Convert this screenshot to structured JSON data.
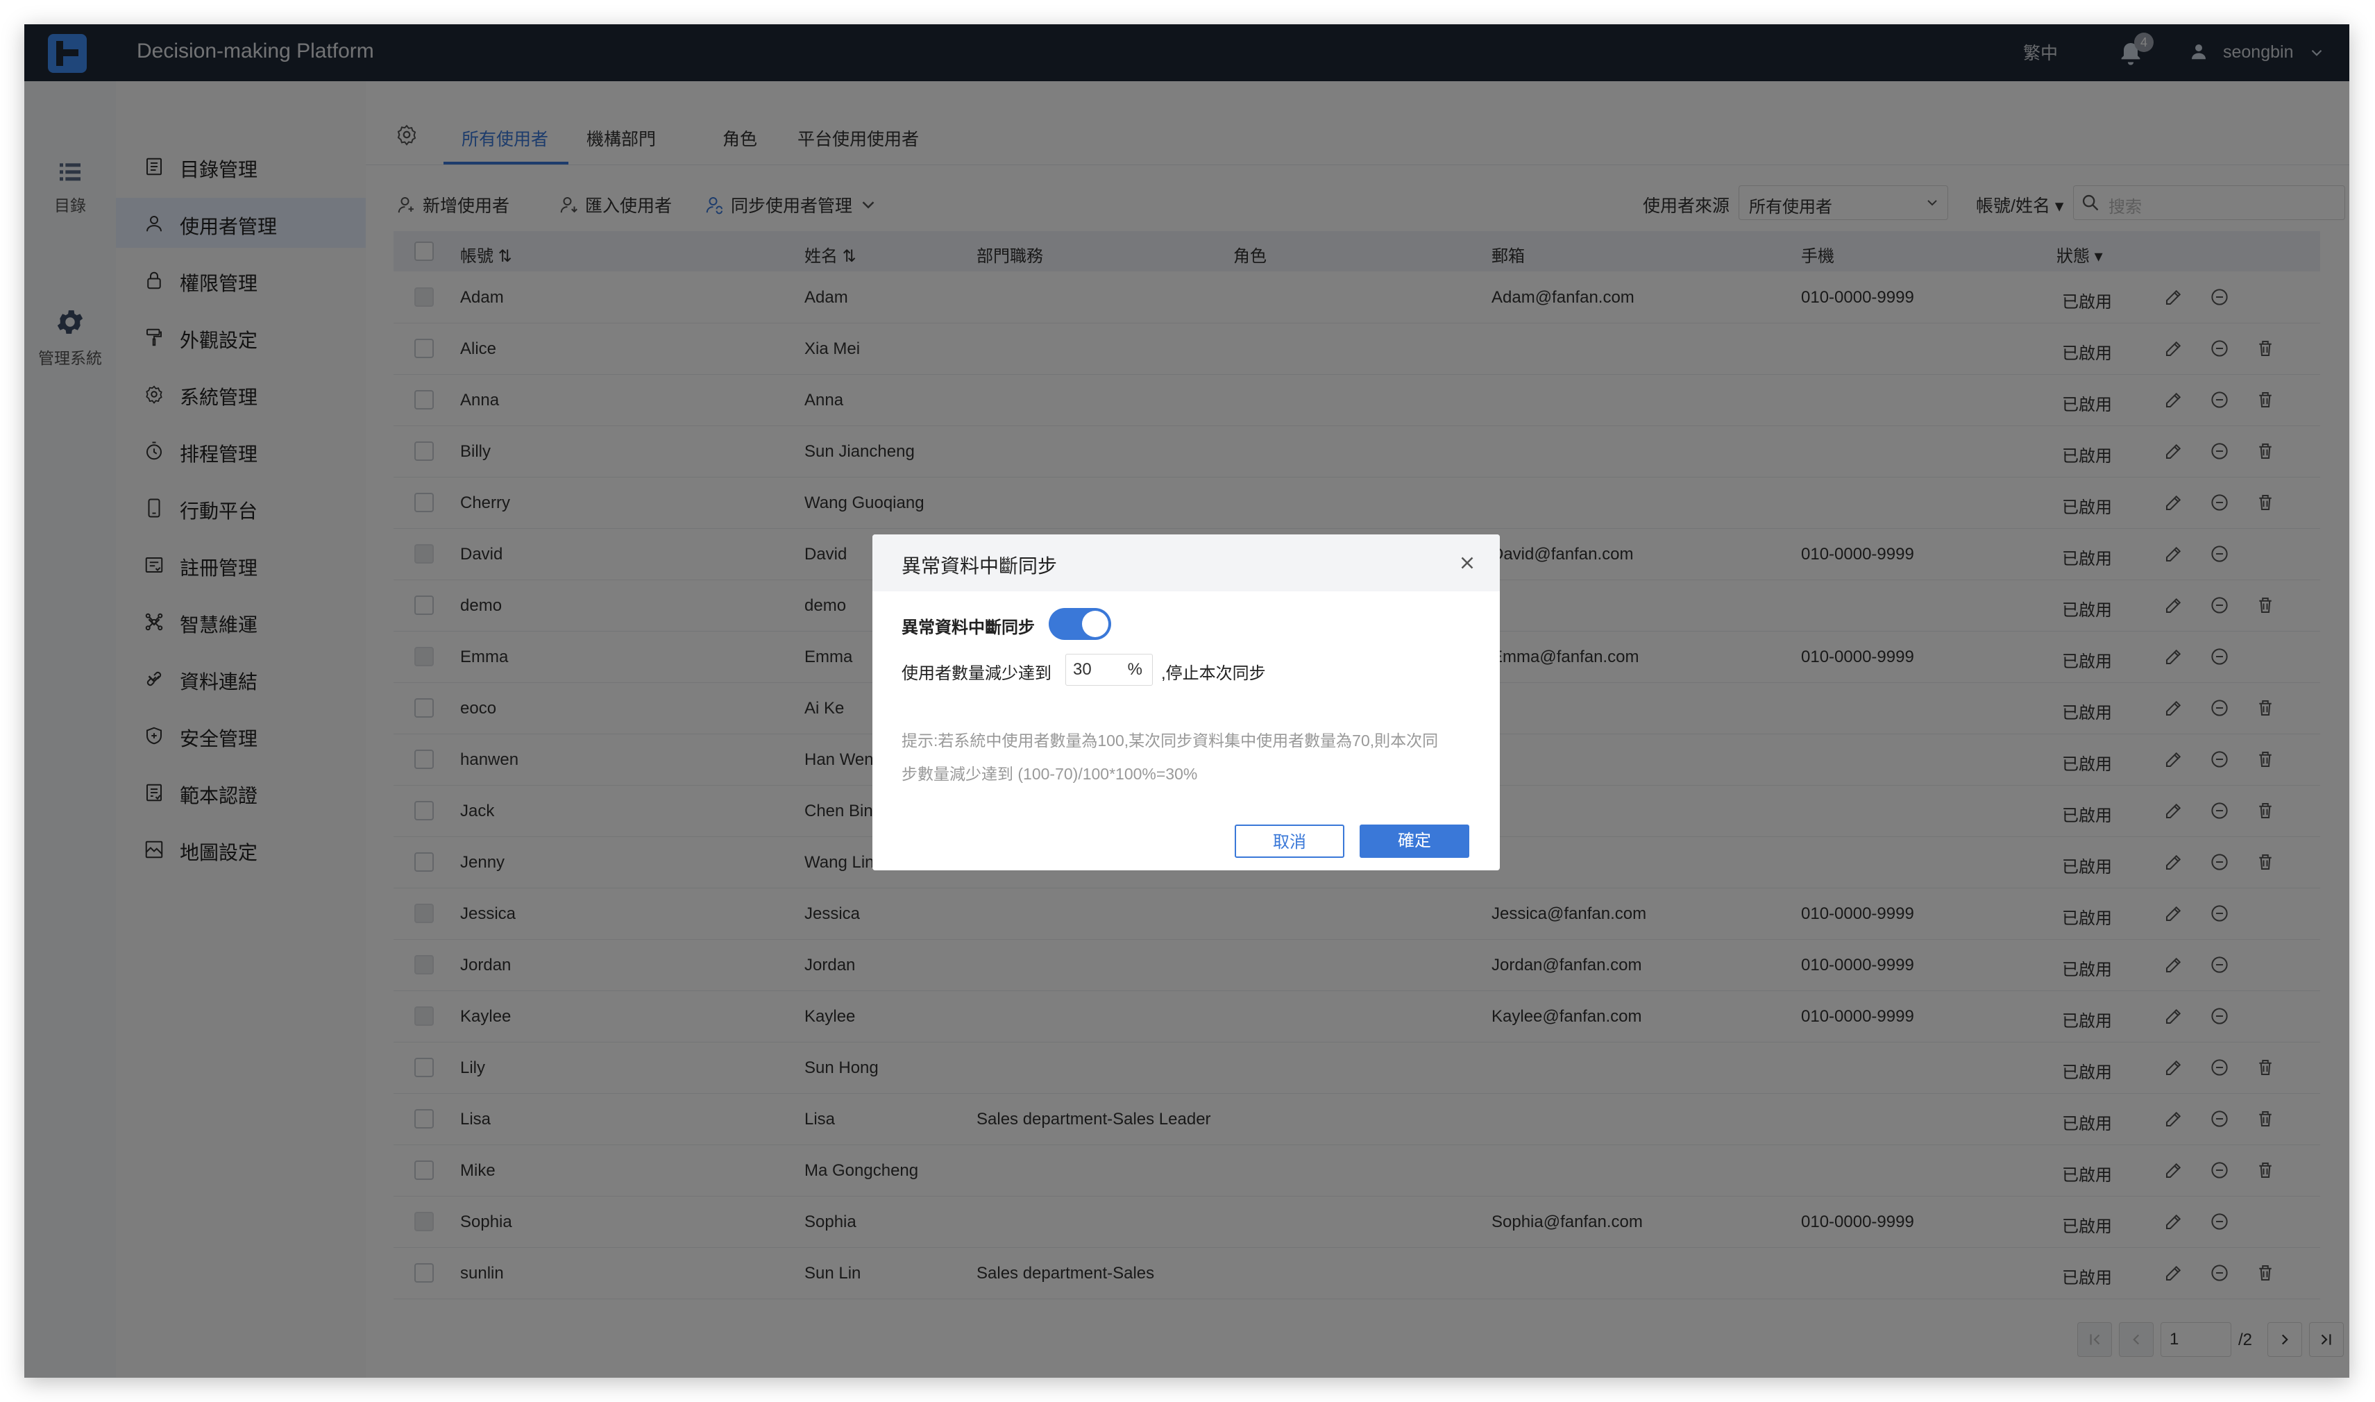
{
  "app": {
    "title": "Decision-making Platform",
    "language": "繁中",
    "notification_count": "4",
    "username": "seongbin"
  },
  "rail": [
    {
      "label": "目錄",
      "icon": "list-icon"
    },
    {
      "label": "管理系統",
      "icon": "gear-icon"
    }
  ],
  "sidebar": {
    "items": [
      {
        "label": "目錄管理",
        "icon": "catalog-icon",
        "active": false
      },
      {
        "label": "使用者管理",
        "icon": "user-icon",
        "active": true
      },
      {
        "label": "權限管理",
        "icon": "lock-icon",
        "active": false
      },
      {
        "label": "外觀設定",
        "icon": "paint-roller-icon",
        "active": false
      },
      {
        "label": "系統管理",
        "icon": "settings-icon",
        "active": false
      },
      {
        "label": "排程管理",
        "icon": "timer-icon",
        "active": false
      },
      {
        "label": "行動平台",
        "icon": "mobile-icon",
        "active": false
      },
      {
        "label": "註冊管理",
        "icon": "register-icon",
        "active": false
      },
      {
        "label": "智慧維運",
        "icon": "network-icon",
        "active": false,
        "expandable": true
      },
      {
        "label": "資料連結",
        "icon": "link-icon",
        "active": false,
        "expandable": true
      },
      {
        "label": "安全管理",
        "icon": "shield-icon",
        "active": false
      },
      {
        "label": "範本認證",
        "icon": "template-icon",
        "active": false
      },
      {
        "label": "地圖設定",
        "icon": "map-icon",
        "active": false
      }
    ]
  },
  "tabs": [
    {
      "label": "所有使用者",
      "active": true
    },
    {
      "label": "機構部門",
      "active": false
    },
    {
      "label": "角色",
      "active": false
    },
    {
      "label": "平台使用使用者",
      "active": false
    }
  ],
  "toolbar": {
    "add_user": "新增使用者",
    "import_user": "匯入使用者",
    "sync_user": "同步使用者管理",
    "source_label": "使用者來源",
    "source_value": "所有使用者",
    "search_field": "帳號/姓名",
    "search_placeholder": "搜索"
  },
  "table": {
    "columns": [
      "帳號",
      "姓名",
      "部門職務",
      "角色",
      "郵箱",
      "手機",
      "狀態"
    ],
    "rows": [
      {
        "account": "Adam",
        "name": "Adam",
        "dept": "",
        "role": "",
        "email": "Adam@fanfan.com",
        "phone": "010-0000-9999",
        "status": "已啟用",
        "deletable": false
      },
      {
        "account": "Alice",
        "name": "Xia Mei",
        "dept": "",
        "role": "",
        "email": "",
        "phone": "",
        "status": "已啟用",
        "deletable": true
      },
      {
        "account": "Anna",
        "name": "Anna",
        "dept": "",
        "role": "",
        "email": "",
        "phone": "",
        "status": "已啟用",
        "deletable": true
      },
      {
        "account": "Billy",
        "name": "Sun Jiancheng",
        "dept": "",
        "role": "",
        "email": "",
        "phone": "",
        "status": "已啟用",
        "deletable": true
      },
      {
        "account": "Cherry",
        "name": "Wang Guoqiang",
        "dept": "",
        "role": "",
        "email": "",
        "phone": "",
        "status": "已啟用",
        "deletable": true
      },
      {
        "account": "David",
        "name": "David",
        "dept": "",
        "role": "",
        "email": "David@fanfan.com",
        "phone": "010-0000-9999",
        "status": "已啟用",
        "deletable": false
      },
      {
        "account": "demo",
        "name": "demo",
        "dept": "",
        "role": "",
        "email": "",
        "phone": "",
        "status": "已啟用",
        "deletable": true
      },
      {
        "account": "Emma",
        "name": "Emma",
        "dept": "",
        "role": "",
        "email": "Emma@fanfan.com",
        "phone": "010-0000-9999",
        "status": "已啟用",
        "deletable": false
      },
      {
        "account": "eoco",
        "name": "Ai Ke",
        "dept": "",
        "role": "",
        "email": "",
        "phone": "",
        "status": "已啟用",
        "deletable": true
      },
      {
        "account": "hanwen",
        "name": "Han Wen",
        "dept": "",
        "role": "",
        "email": "",
        "phone": "",
        "status": "已啟用",
        "deletable": true
      },
      {
        "account": "Jack",
        "name": "Chen Bin",
        "dept": "",
        "role": "",
        "email": "",
        "phone": "",
        "status": "已啟用",
        "deletable": true
      },
      {
        "account": "Jenny",
        "name": "Wang Lin",
        "dept": "",
        "role": "",
        "email": "",
        "phone": "",
        "status": "已啟用",
        "deletable": true
      },
      {
        "account": "Jessica",
        "name": "Jessica",
        "dept": "",
        "role": "",
        "email": "Jessica@fanfan.com",
        "phone": "010-0000-9999",
        "status": "已啟用",
        "deletable": false
      },
      {
        "account": "Jordan",
        "name": "Jordan",
        "dept": "",
        "role": "",
        "email": "Jordan@fanfan.com",
        "phone": "010-0000-9999",
        "status": "已啟用",
        "deletable": false
      },
      {
        "account": "Kaylee",
        "name": "Kaylee",
        "dept": "",
        "role": "",
        "email": "Kaylee@fanfan.com",
        "phone": "010-0000-9999",
        "status": "已啟用",
        "deletable": false
      },
      {
        "account": "Lily",
        "name": "Sun Hong",
        "dept": "",
        "role": "",
        "email": "",
        "phone": "",
        "status": "已啟用",
        "deletable": true
      },
      {
        "account": "Lisa",
        "name": "Lisa",
        "dept": "Sales department-Sales Leader",
        "role": "",
        "email": "",
        "phone": "",
        "status": "已啟用",
        "deletable": true
      },
      {
        "account": "Mike",
        "name": "Ma Gongcheng",
        "dept": "",
        "role": "",
        "email": "",
        "phone": "",
        "status": "已啟用",
        "deletable": true
      },
      {
        "account": "Sophia",
        "name": "Sophia",
        "dept": "",
        "role": "",
        "email": "Sophia@fanfan.com",
        "phone": "010-0000-9999",
        "status": "已啟用",
        "deletable": false
      },
      {
        "account": "sunlin",
        "name": "Sun Lin",
        "dept": "Sales department-Sales",
        "role": "",
        "email": "",
        "phone": "",
        "status": "已啟用",
        "deletable": true
      }
    ]
  },
  "pagination": {
    "current_page": "1",
    "total_pages": "/2"
  },
  "dialog": {
    "title": "異常資料中斷同步",
    "toggle_label": "異常資料中斷同步",
    "toggle_on": true,
    "threshold_label": "使用者數量減少達到",
    "threshold_value": "30",
    "threshold_unit": "%",
    "threshold_suffix": ",停止本次同步",
    "hint_line1": "提示:若系統中使用者數量為100,某次同步資料集中使用者數量為70,則本次同",
    "hint_line2": "步數量減少達到 (100-70)/100*100%=30%",
    "cancel": "取消",
    "confirm": "確定"
  },
  "colors": {
    "accent": "#3a78d8",
    "topbar": "#1f2937",
    "overlay": "rgba(0,0,0,0.5)"
  }
}
